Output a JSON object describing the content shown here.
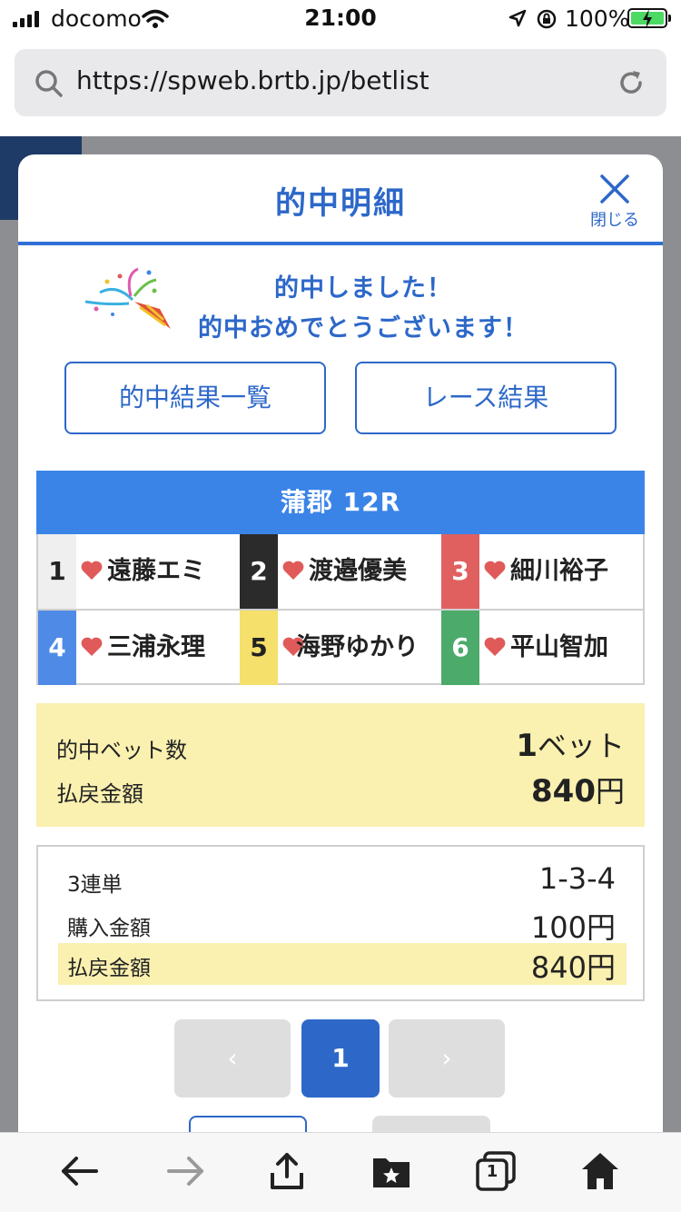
{
  "status_bar": {
    "carrier": "docomo",
    "time": "21:00",
    "battery_percent": "100%"
  },
  "browser": {
    "url": "https://spweb.brtb.jp/betlist"
  },
  "modal": {
    "title": "的中明細",
    "close_label": "閉じる",
    "congrats_line1": "的中しました！",
    "congrats_line2": "的中おめでとうございます！",
    "buttons": {
      "hit_list": "的中結果一覧",
      "race_result": "レース結果"
    },
    "race": {
      "title": "蒲郡 12R",
      "racers": [
        {
          "number": "1",
          "name": "遠藤エミ",
          "color": "#efefef"
        },
        {
          "number": "2",
          "name": "渡邉優美",
          "color": "#2b2b2b"
        },
        {
          "number": "3",
          "name": "細川裕子",
          "color": "#e06060"
        },
        {
          "number": "4",
          "name": "三浦永理",
          "color": "#4f8be6"
        },
        {
          "number": "5",
          "name": "海野ゆかり",
          "color": "#f4e06a"
        },
        {
          "number": "6",
          "name": "平山智加",
          "color": "#4caa6a"
        }
      ]
    },
    "summary": {
      "hit_bets_label": "的中ベット数",
      "hit_bets_value": "1",
      "hit_bets_unit": "ベット",
      "payout_label": "払戻金額",
      "payout_value": "840",
      "payout_unit": "円"
    },
    "detail": {
      "bet_type": "3連単",
      "combination": "1-3-4",
      "purchase_label": "購入金額",
      "purchase_value": "100円",
      "payout_label": "払戻金額",
      "payout_value": "840円"
    },
    "pager": {
      "prev": "‹",
      "current": "1",
      "next": "›"
    }
  },
  "toolbar": {
    "tabs_count": "1"
  },
  "colors": {
    "accent": "#2d68c9",
    "race_header": "#3a84e8",
    "highlight": "#faf0b0",
    "heart": "#e05a5a"
  }
}
